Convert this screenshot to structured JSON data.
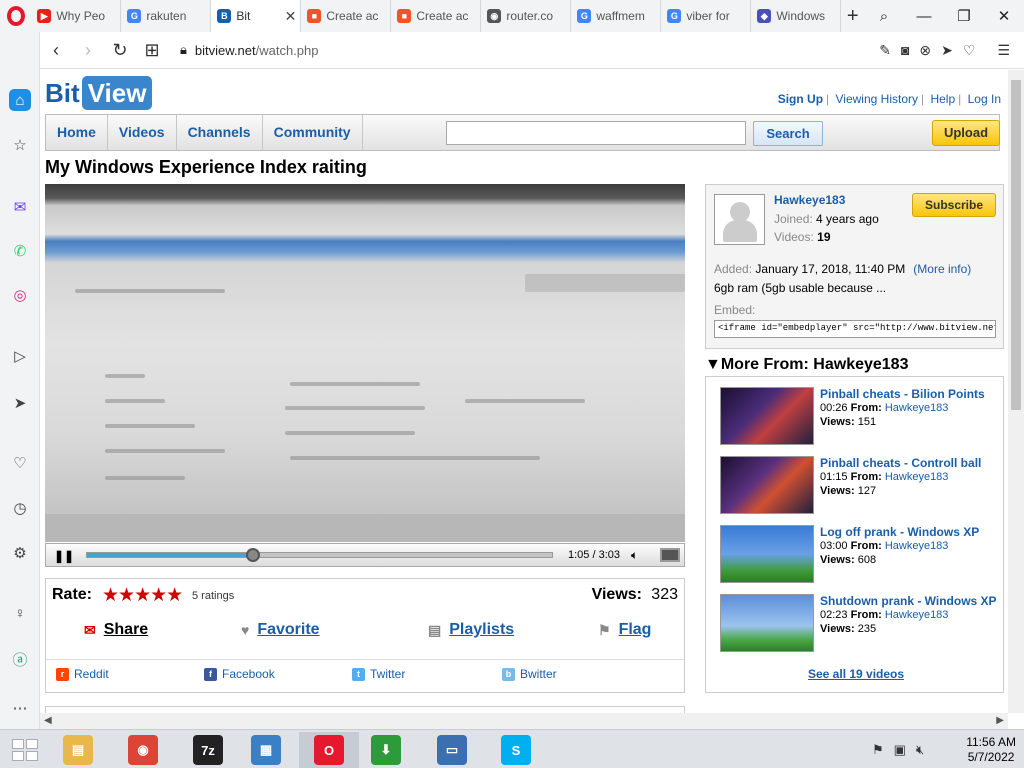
{
  "browser": {
    "tabs": [
      {
        "title": "Why Peo",
        "fav_color": "#e62117",
        "fav_glyph": "▶",
        "active": false
      },
      {
        "title": "rakuten",
        "fav_color": "#4285f4",
        "fav_glyph": "G",
        "active": false
      },
      {
        "title": "Bit",
        "fav_color": "#1a5ea8",
        "fav_glyph": "B",
        "active": true
      },
      {
        "title": "Create ac",
        "fav_color": "#f35325",
        "fav_glyph": "■",
        "active": false
      },
      {
        "title": "Create ac",
        "fav_color": "#f35325",
        "fav_glyph": "■",
        "active": false
      },
      {
        "title": "router.co",
        "fav_color": "#555555",
        "fav_glyph": "◉",
        "active": false
      },
      {
        "title": "waffmem",
        "fav_color": "#4285f4",
        "fav_glyph": "G",
        "active": false
      },
      {
        "title": "viber for",
        "fav_color": "#4285f4",
        "fav_glyph": "G",
        "active": false
      },
      {
        "title": "Windows",
        "fav_color": "#4b4fb8",
        "fav_glyph": "◆",
        "active": false
      }
    ],
    "new_tab": "+",
    "url_domain": "bitview.net",
    "url_path": "/watch.php"
  },
  "site": {
    "logo_bit": "Bit",
    "logo_view": "View",
    "links": {
      "signup": "Sign Up",
      "history": "Viewing History",
      "help": "Help",
      "login": "Log In"
    },
    "nav": [
      "Home",
      "Videos",
      "Channels",
      "Community"
    ],
    "search_label": "Search",
    "search_placeholder": "",
    "upload_label": "Upload"
  },
  "video": {
    "title": "My Windows Experience Index raiting",
    "time": "1:05 / 3:03",
    "progress": 0.357
  },
  "info": {
    "rate_label": "Rate:",
    "stars": "★★★★★",
    "ratings": "5 ratings",
    "views_label": "Views:",
    "views": "323",
    "share": "Share",
    "favorite": "Favorite",
    "playlists": "Playlists",
    "flag": "Flag",
    "reddit": "Reddit",
    "facebook": "Facebook",
    "twitter": "Twitter",
    "bwitter": "Bwitter"
  },
  "channel": {
    "name": "Hawkeye183",
    "joined_label": "Joined:",
    "joined": "4 years ago",
    "videos_label": "Videos:",
    "videos": "19",
    "subscribe": "Subscribe",
    "added_label": "Added:",
    "added": "January 17, 2018, 11:40 PM",
    "more_info": "(More info)",
    "description": "6gb ram (5gb usable because ...",
    "embed_label": "Embed:",
    "embed_code": "<iframe id=\"embedplayer\" src=\"http://www.bitview.net/embed.php"
  },
  "more_from": {
    "header": "More From: Hawkeye183",
    "from_label": "From:",
    "views_label": "Views:",
    "items": [
      {
        "title": "Pinball cheats - Bilion Points",
        "duration": "00:26",
        "author": "Hawkeye183",
        "views": "151"
      },
      {
        "title": "Pinball cheats - Controll ball",
        "duration": "01:15",
        "author": "Hawkeye183",
        "views": "127"
      },
      {
        "title": "Log off prank - Windows XP",
        "duration": "03:00",
        "author": "Hawkeye183",
        "views": "608"
      },
      {
        "title": "Shutdown prank - Windows XP",
        "duration": "02:23",
        "author": "Hawkeye183",
        "views": "235"
      }
    ],
    "see_all": "See all 19 videos"
  },
  "taskbar": {
    "time": "11:56 AM",
    "date": "5/7/2022",
    "apps": [
      {
        "name": "explorer",
        "glyph": "▤",
        "color": "#e8b84a"
      },
      {
        "name": "chrome",
        "glyph": "◉",
        "color": "#db4437"
      },
      {
        "name": "7zip",
        "glyph": "7z",
        "color": "#222222"
      },
      {
        "name": "control-panel",
        "glyph": "▦",
        "color": "#3b7fc4"
      },
      {
        "name": "opera",
        "glyph": "O",
        "color": "#e6182e"
      },
      {
        "name": "download",
        "glyph": "⬇",
        "color": "#2d9b3a"
      },
      {
        "name": "computer",
        "glyph": "▭",
        "color": "#3b6fb0"
      },
      {
        "name": "skype",
        "glyph": "S",
        "color": "#00aff0"
      }
    ]
  }
}
